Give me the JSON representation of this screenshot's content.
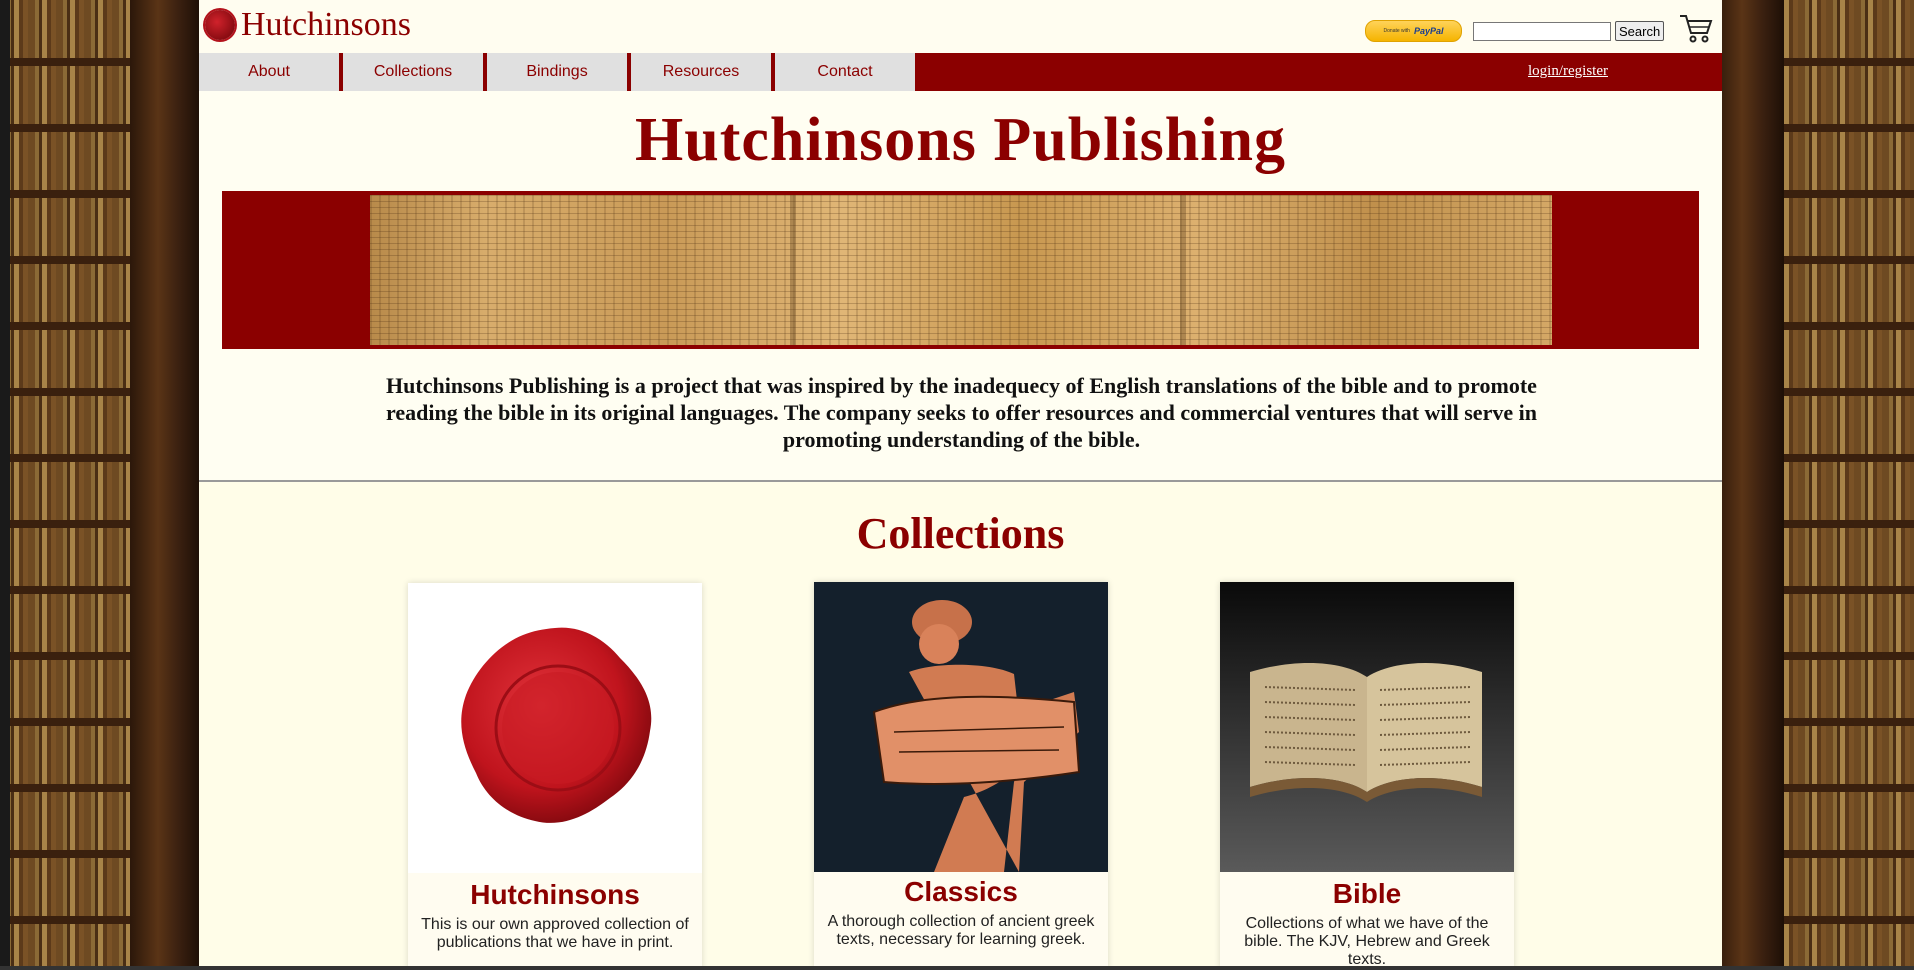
{
  "brand": {
    "name": "Hutchinsons"
  },
  "paypal": {
    "small_text": "Donate with",
    "logo_text": "PayPal"
  },
  "search": {
    "placeholder": "",
    "button_label": "Search"
  },
  "nav": {
    "items": [
      {
        "label": "About"
      },
      {
        "label": "Collections"
      },
      {
        "label": "Bindings"
      },
      {
        "label": "Resources"
      },
      {
        "label": "Contact"
      }
    ],
    "login_label": "login/register"
  },
  "hero": {
    "title": "Hutchinsons Publishing",
    "intro": "Hutchinsons Publishing is a project that was inspired by the inadequecy of English translations of the bible and to promote reading the bible in its original languages. The company seeks to offer resources and commercial ventures that will serve in promoting understanding of the bible."
  },
  "collections": {
    "title": "Collections",
    "cards": [
      {
        "title": "Hutchinsons",
        "text": "This is our own approved collection of publications that we have in print."
      },
      {
        "title": "Classics",
        "text": "A thorough collection of ancient greek texts, necessary for learning greek."
      },
      {
        "title": "Bible",
        "text": "Collections of what we have of the bible. The KJV, Hebrew and Greek texts."
      }
    ]
  },
  "colors": {
    "accent": "#8b0000",
    "nav_tab": "#e0e0e0",
    "page_bg": "#fffef2"
  }
}
